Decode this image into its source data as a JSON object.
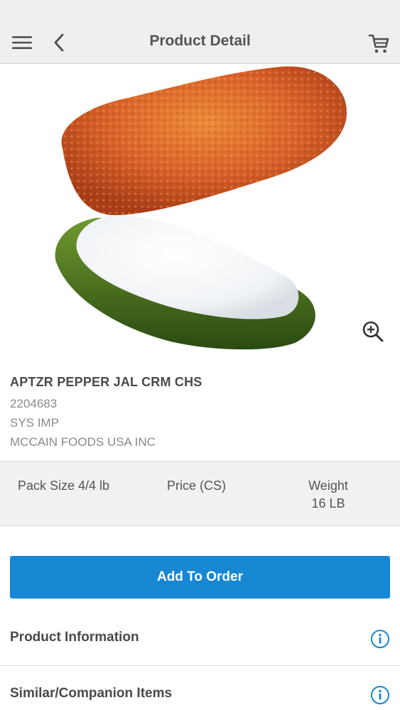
{
  "header": {
    "title": "Product Detail",
    "icons": {
      "menu": "hamburger-menu-icon",
      "back": "chevron-left-icon",
      "cart": "shopping-cart-icon"
    }
  },
  "product": {
    "name": "APTZR PEPPER JAL CRM CHS",
    "code": "2204683",
    "brand": "SYS IMP",
    "manufacturer": "MCCAIN FOODS USA INC",
    "image": "jalapeno-popper-image"
  },
  "stats": {
    "pack_size": "Pack Size 4/4 lb",
    "price_label": "Price (CS)",
    "weight_label": "Weight",
    "weight_value": "16 LB"
  },
  "actions": {
    "add_to_order": "Add To Order"
  },
  "sections": [
    {
      "label": "Product Information",
      "icon": "info-icon"
    },
    {
      "label": "Similar/Companion Items",
      "icon": "info-icon"
    }
  ],
  "colors": {
    "accent": "#1787d3",
    "header_bg": "#efeff1"
  }
}
